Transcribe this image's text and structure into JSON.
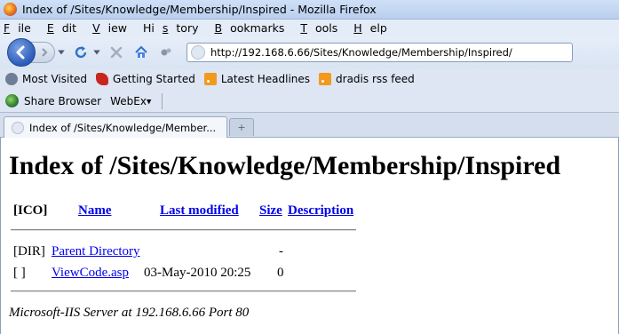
{
  "window": {
    "title": "Index of /Sites/Knowledge/Membership/Inspired - Mozilla Firefox"
  },
  "menu": [
    {
      "label": "File",
      "accel": "F",
      "rest": "ile"
    },
    {
      "label": "Edit",
      "accel": "E",
      "rest": "dit"
    },
    {
      "label": "View",
      "accel": "V",
      "rest": "iew"
    },
    {
      "label": "History",
      "accel": "s",
      "pre": "Hi",
      "rest": "tory"
    },
    {
      "label": "Bookmarks",
      "accel": "B",
      "rest": "ookmarks"
    },
    {
      "label": "Tools",
      "accel": "T",
      "rest": "ools"
    },
    {
      "label": "Help",
      "accel": "H",
      "rest": "elp"
    }
  ],
  "navbar": {
    "url": "http://192.168.6.66/Sites/Knowledge/Membership/Inspired/"
  },
  "bookmarks": {
    "most_visited": "Most Visited",
    "getting_started": "Getting Started",
    "latest_headlines": "Latest Headlines",
    "dradis_feed": "dradis rss feed"
  },
  "sharebar": {
    "share_browser": "Share Browser",
    "webex": "WebEx"
  },
  "tabs": {
    "active_title": "Index of /Sites/Knowledge/Member...",
    "new_tab_symbol": "+"
  },
  "page": {
    "heading": "Index of /Sites/Knowledge/Membership/Inspired",
    "columns": {
      "ico": "[ICO]",
      "name": "Name",
      "last_modified": "Last modified",
      "size": "Size",
      "description": "Description"
    },
    "rows": [
      {
        "icon": "[DIR]",
        "name": "Parent Directory",
        "modified": "",
        "size": "-"
      },
      {
        "icon": "[ ]",
        "name": "ViewCode.asp",
        "modified": "03-May-2010 20:25",
        "size": "0"
      }
    ],
    "footer": "Microsoft-IIS Server at 192.168.6.66 Port 80"
  }
}
